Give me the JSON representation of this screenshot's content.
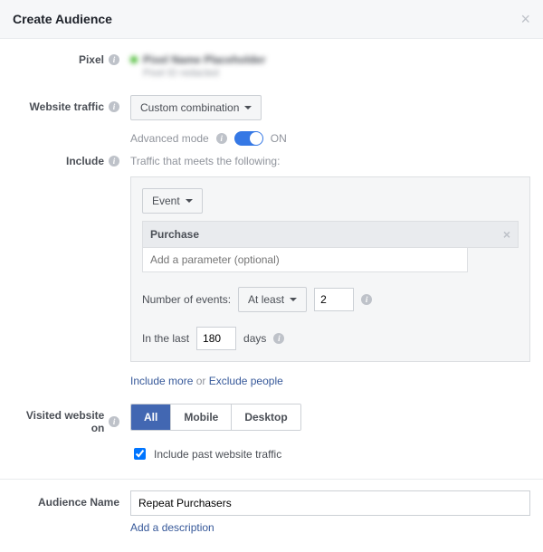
{
  "modal": {
    "title": "Create Audience"
  },
  "labels": {
    "pixel": "Pixel",
    "website_traffic": "Website traffic",
    "include": "Include",
    "visited_on": "Visited website on",
    "audience_name": "Audience Name"
  },
  "pixel": {
    "name": "Pixel Name Placeholder",
    "sub": "Pixel ID redacted"
  },
  "traffic": {
    "selected": "Custom combination",
    "advanced_mode_label": "Advanced mode",
    "advanced_mode_on": "ON"
  },
  "include": {
    "heading": "Traffic that meets the following:",
    "event_selector": "Event",
    "event_name": "Purchase",
    "param_placeholder": "Add a parameter (optional)",
    "num_events_label": "Number of events:",
    "num_events_comparator": "At least",
    "num_events_value": "2",
    "in_last_label": "In the last",
    "in_last_value": "180",
    "days_label": "days",
    "include_more": "Include more",
    "or": " or ",
    "exclude_people": "Exclude people"
  },
  "visited": {
    "options": [
      "All",
      "Mobile",
      "Desktop"
    ],
    "active": "All",
    "include_past_label": "Include past website traffic"
  },
  "audience": {
    "name": "Repeat Purchasers",
    "add_desc": "Add a description"
  }
}
